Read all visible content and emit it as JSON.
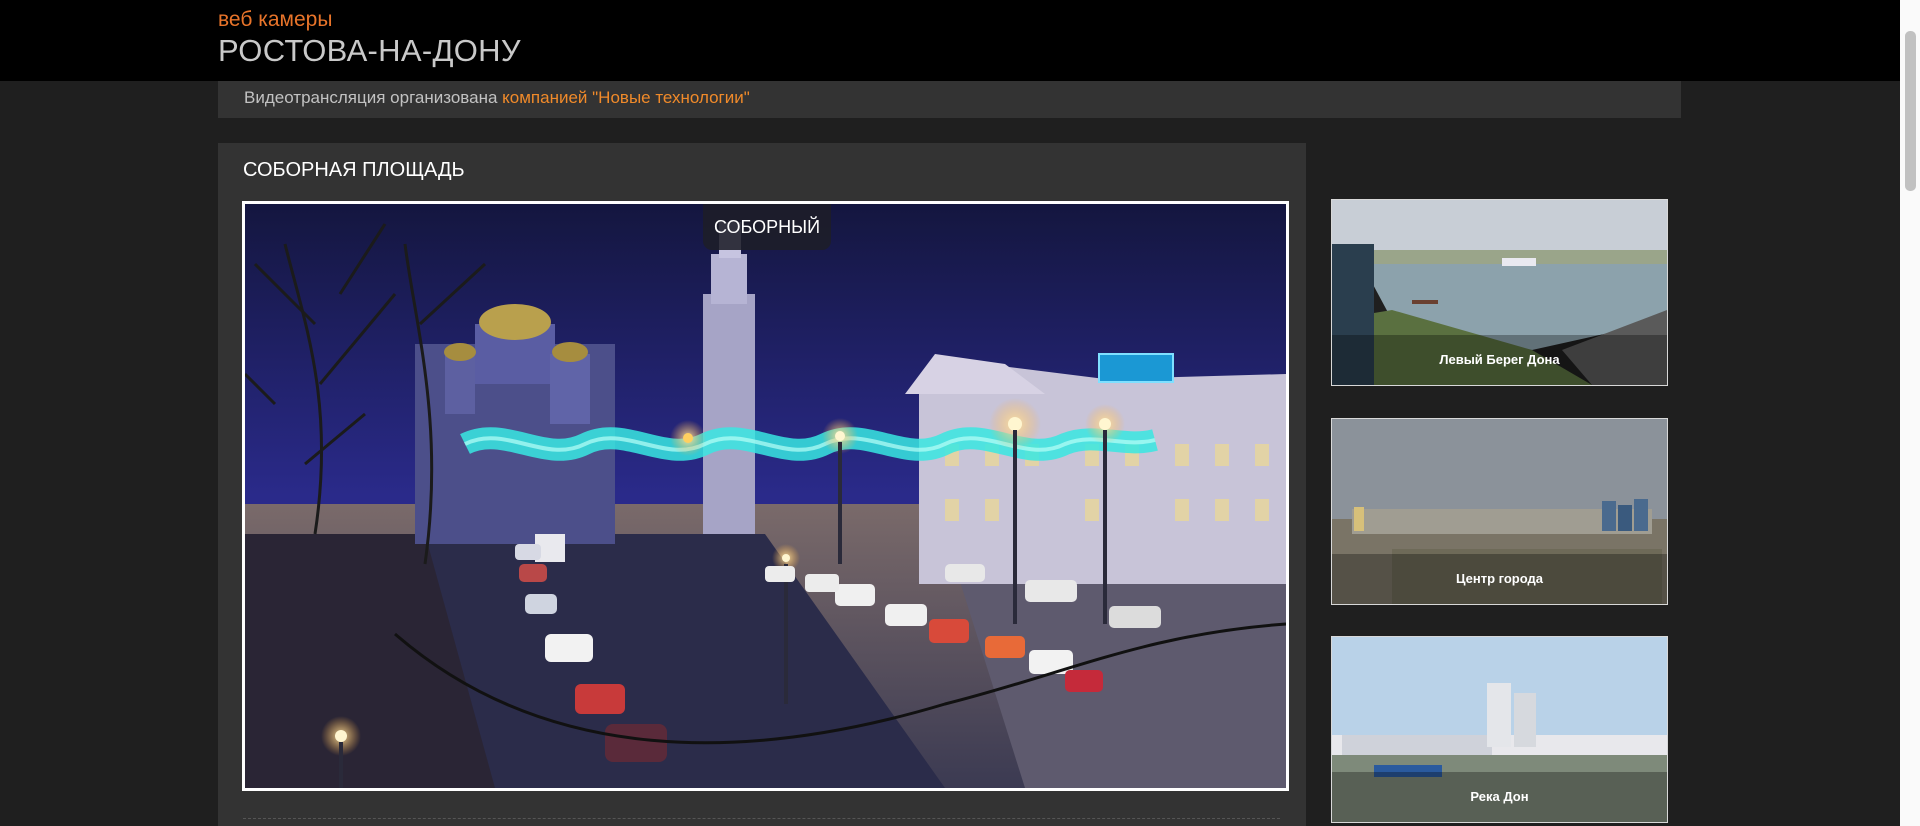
{
  "header": {
    "subtitle": "веб камеры",
    "title": "РОСТОВА-НА-ДОНУ"
  },
  "notice": {
    "text": "Видеотрансляция организована ",
    "link_label": "компанией \"Новые технологии\""
  },
  "main_camera": {
    "title": "СОБОРНАЯ ПЛОЩАДЬ",
    "overlay_label": "СОБОРНЫЙ"
  },
  "thumbnails": [
    {
      "label": "Левый Берег Дона"
    },
    {
      "label": "Центр города"
    },
    {
      "label": "Река Дон"
    }
  ],
  "colors": {
    "accent": "#f08a2a",
    "header_bg": "#000000",
    "page_bg": "#1f1f1f",
    "panel_bg": "#333333"
  }
}
